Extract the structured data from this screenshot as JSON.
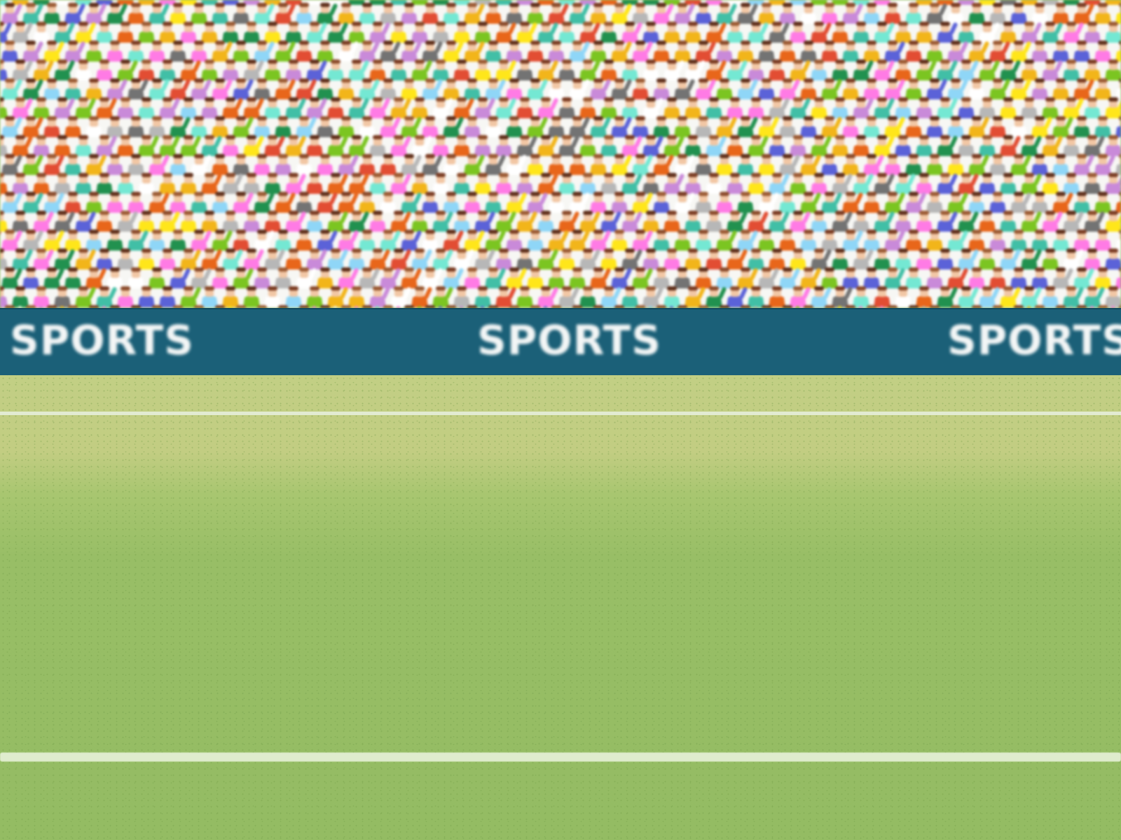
{
  "scene": {
    "banner": {
      "left_text": "SPORTS",
      "center_text": "SPORTS",
      "right_text": "SPORTS"
    },
    "colors": {
      "banner_bg": "#1b6078",
      "banner_text": "#f3f6f6",
      "field_green": "#94bc63",
      "field_far": "#c2cf84",
      "line_white": "#e4ecd6",
      "crowd_shirts": [
        "#e8661a",
        "#f2b51a",
        "#ff7be5",
        "#74e8d3",
        "#b7b7b7",
        "#737373",
        "#21914f",
        "#7bc521",
        "#5b62d8",
        "#ffffff",
        "#ffe61a",
        "#c98ad9",
        "#8fd6f7",
        "#e24d33",
        "#41bfa6"
      ]
    }
  }
}
